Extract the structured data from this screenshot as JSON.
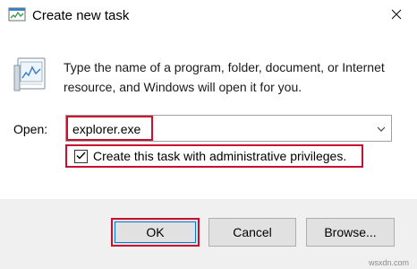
{
  "window": {
    "title": "Create new task",
    "title_icon": "task-manager-icon",
    "close_icon": "close-icon"
  },
  "body": {
    "icon": "run-program-icon",
    "description": "Type the name of a program, folder, document, or Internet resource, and Windows will open it for you.",
    "open_label": "Open:",
    "open_value": "explorer.exe",
    "dropdown_icon": "chevron-down-icon",
    "admin_checkbox_label": "Create this task with administrative privileges.",
    "admin_checkbox_checked": true
  },
  "buttons": {
    "ok": "OK",
    "cancel": "Cancel",
    "browse": "Browse..."
  },
  "watermark": "wsxdn.com",
  "colors": {
    "highlight": "#c8102e",
    "focus": "#0078d7",
    "footer_bg": "#f0f0f0",
    "button_bg": "#e1e1e1"
  }
}
